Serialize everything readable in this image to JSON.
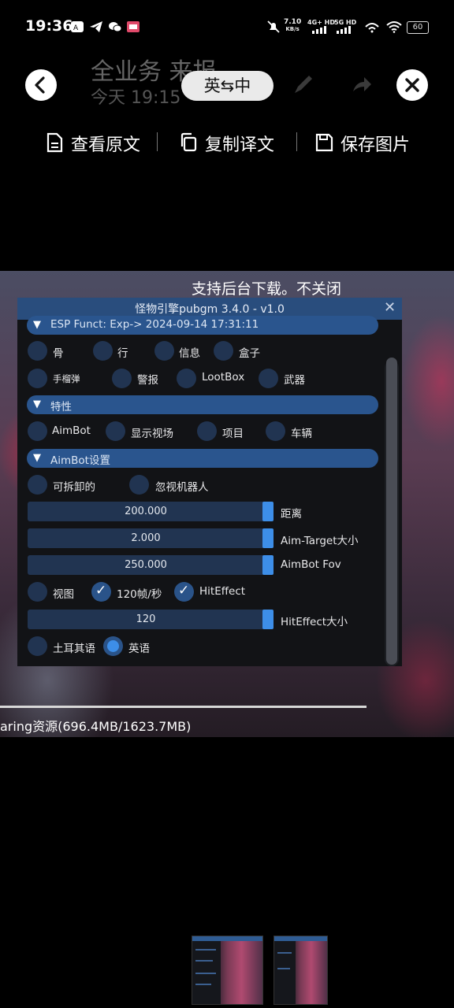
{
  "status_bar": {
    "time": "19:36",
    "speed_value": "7.10",
    "speed_unit": "KB/s",
    "net1": "4G+ HD",
    "net2": "5G HD",
    "battery": "60"
  },
  "header": {
    "ghost_title": "全业务 来报",
    "ghost_subtitle": "今天 19:15",
    "lang_toggle": "英⇆中"
  },
  "actions": [
    {
      "label": "查看原文",
      "icon": "document-icon"
    },
    {
      "label": "复制译文",
      "icon": "copy-icon"
    },
    {
      "label": "保存图片",
      "icon": "save-icon"
    }
  ],
  "screenshot": {
    "banner": "支持后台下载。不关闭",
    "download_text": "aring资源(696.4MB/1623.7MB)",
    "panel": {
      "title": "怪物引擎pubgm 3.4.0 - v1.0",
      "close": "✕",
      "section_esp": "ESP Funct: Exp-> 2024-09-14 17:31:11",
      "esp_row1": [
        "骨",
        "行",
        "信息",
        "盒子"
      ],
      "esp_row2": [
        "手榴弹",
        "警报",
        "LootBox",
        "武器"
      ],
      "section_features": "特性",
      "feature_row": [
        "AimBot",
        "显示视场",
        "项目",
        "车辆"
      ],
      "section_aimbot": "AimBot设置",
      "aim_row": [
        "可拆卸的",
        "忽视机器人"
      ],
      "sliders": [
        {
          "value": "200.000",
          "label": "距离"
        },
        {
          "value": "2.000",
          "label": "Aim-Target大小"
        },
        {
          "value": "250.000",
          "label": "AimBot Fov"
        }
      ],
      "view_row": [
        {
          "label": "视图",
          "checked": false
        },
        {
          "label": "120帧/秒",
          "checked": true
        },
        {
          "label": "HitEffect",
          "checked": true
        }
      ],
      "hit_slider": {
        "value": "120",
        "label": "HitEffect大小"
      },
      "lang_row": [
        {
          "label": "土耳其语",
          "selected": false
        },
        {
          "label": "英语",
          "selected": true
        }
      ],
      "tri": "▼",
      "check": "✓"
    }
  },
  "colors": {
    "accent": "#3d8ee8",
    "section_bg": "#2a558e",
    "title_bg": "#294d7d",
    "panel_bg": "#121316"
  }
}
